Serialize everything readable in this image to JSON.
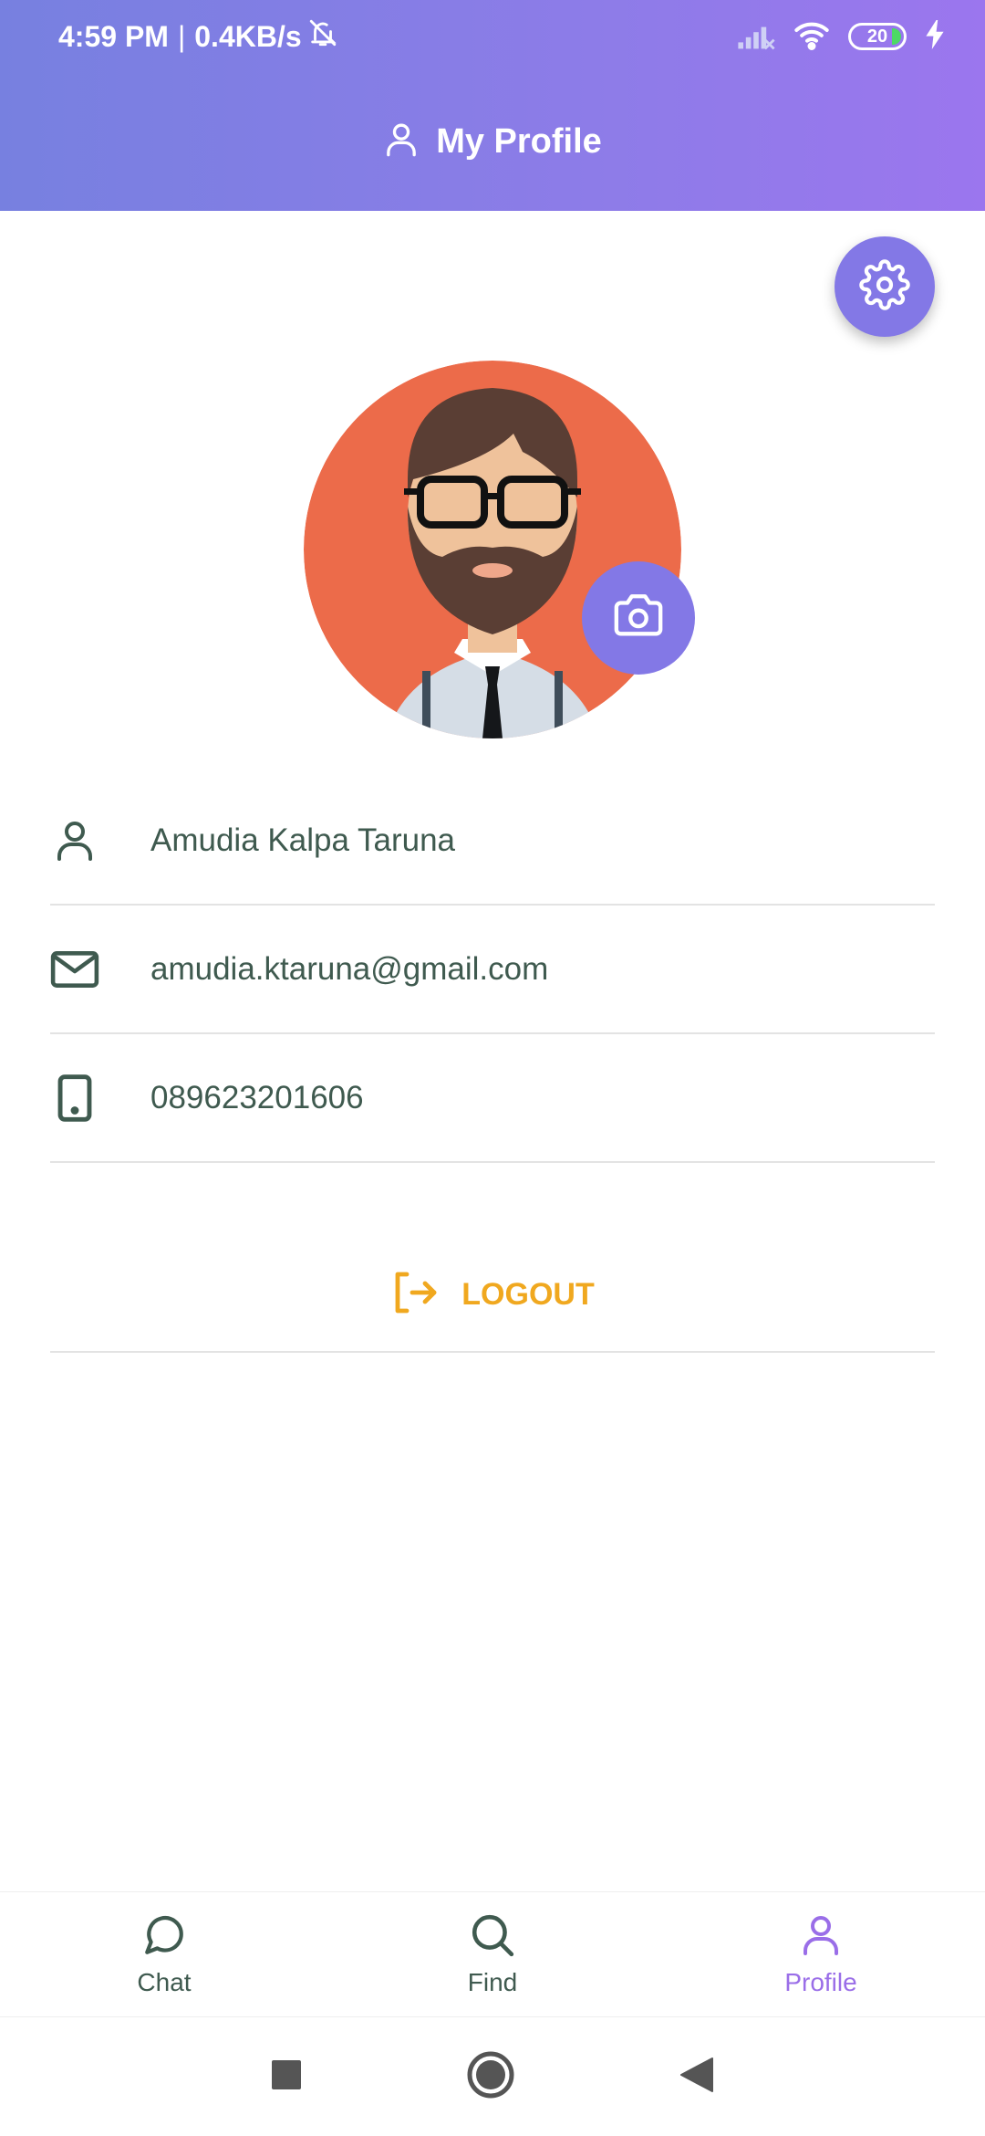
{
  "status_bar": {
    "time": "4:59 PM",
    "separator": "|",
    "net_speed": "0.4KB/s",
    "battery": "20",
    "icons": [
      "bell-off-icon",
      "signal-icon",
      "wifi-icon",
      "battery-icon",
      "charging-icon"
    ]
  },
  "header": {
    "icon": "user-icon",
    "title": "My Profile"
  },
  "settings": {
    "icon": "gear-icon"
  },
  "avatar": {
    "camera_icon": "camera-icon"
  },
  "profile": {
    "name": "Amudia Kalpa Taruna",
    "email": "amudia.ktaruna@gmail.com",
    "phone": "089623201606"
  },
  "logout": {
    "label": "LOGOUT",
    "icon": "logout-icon"
  },
  "bottom_nav": {
    "items": [
      {
        "label": "Chat",
        "icon": "chat-bubble-icon",
        "active": false
      },
      {
        "label": "Find",
        "icon": "search-icon",
        "active": false
      },
      {
        "label": "Profile",
        "icon": "user-icon",
        "active": true
      }
    ]
  },
  "system_nav": [
    "recents-square-icon",
    "home-circle-icon",
    "back-triangle-icon"
  ],
  "colors": {
    "header_gradient_start": "#7780e0",
    "header_gradient_end": "#9b76ee",
    "fab": "#8378e6",
    "text": "#3f5a4f",
    "logout": "#f0a81f",
    "active_tab": "#9a6ee8",
    "avatar_bg": "#ec6b4a"
  }
}
